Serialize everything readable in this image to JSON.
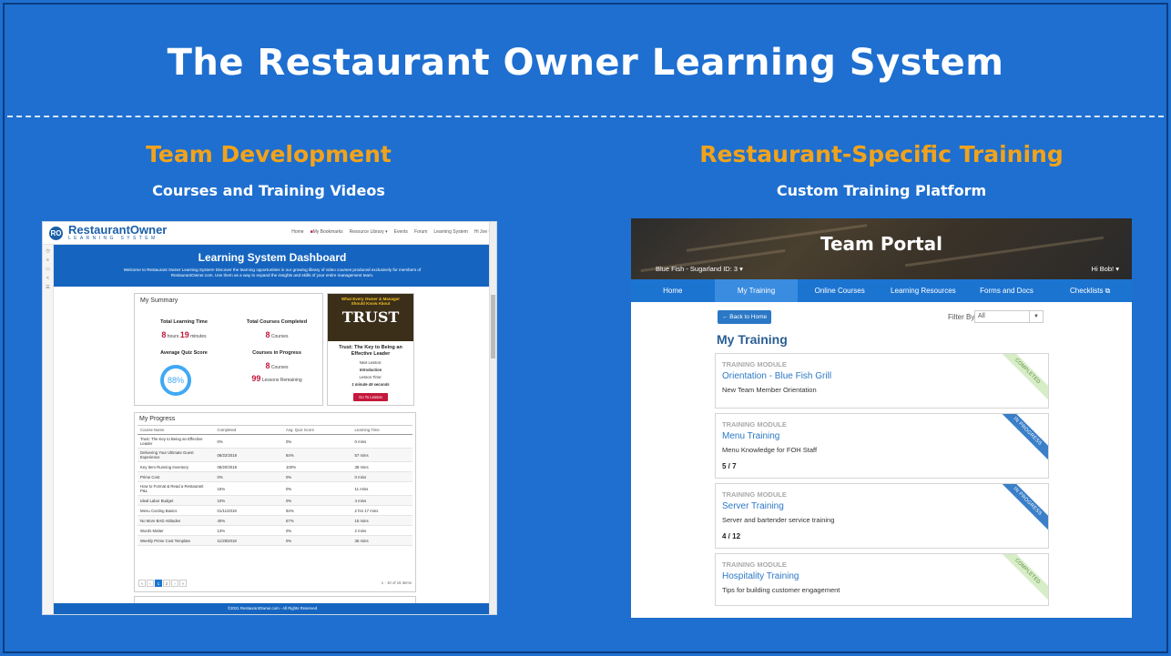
{
  "slide": {
    "title": "The Restaurant Owner Learning System",
    "left_heading": "Team Development",
    "left_subheading": "Courses and Training Videos",
    "right_heading": "Restaurant-Specific Training",
    "right_subheading": "Custom Training Platform"
  },
  "dashboard": {
    "logo_mark": "RO",
    "logo_text": "RestaurantOwner",
    "logo_sub": "LEARNING SYSTEM",
    "nav": [
      "Home",
      "My Bookmarks",
      "Resource Library ▾",
      "Events",
      "Forum",
      "Learning System",
      "Hi Joe ▾"
    ],
    "banner_title": "Learning System Dashboard",
    "banner_text": "Welcome to Restaurant Owner Learning System! Discover the learning opportunities in our growing library of video courses produced exclusively for members of RestaurantOwner.com. Use them as a way to expand the insights and skills of your entire management team.",
    "summary": {
      "title": "My Summary",
      "learning_time_label": "Total Learning Time",
      "hours": "8",
      "hours_unit": "hours",
      "minutes": "19",
      "minutes_unit": "minutes",
      "completed_label": "Total Courses Completed",
      "completed": "8",
      "completed_unit": "Courses",
      "quiz_label": "Average Quiz Score",
      "quiz": "88%",
      "in_progress_label": "Courses in Progress",
      "in_progress": "8",
      "in_progress_unit": "Courses",
      "lessons": "99",
      "lessons_unit": "Lessons Remaining"
    },
    "promo": {
      "img_line1": "What Every Owner & Manager",
      "img_line2": "Should Know About",
      "img_word": "TRUST",
      "title": "Trust: The Key to Being an Effective Leader",
      "next_label": "Next Lesson:",
      "next_value": "Introduction",
      "time_label": "Lesson Time:",
      "time_value": "1 minute 49 seconds",
      "button": "Go To Lesson"
    },
    "progress": {
      "title": "My Progress",
      "columns": [
        "Course Name",
        "Completed",
        "Avg. Quiz Score",
        "Learning Time"
      ],
      "rows": [
        [
          "Trust: The Key to Being an Effective Leader",
          "0%",
          "0%",
          "0 mins"
        ],
        [
          "Delivering Your Ultimate Guest Experience",
          "08/22/2018",
          "84%",
          "57 mins"
        ],
        [
          "Key Item Running Inventory",
          "08/20/2018",
          "100%",
          "38 mins"
        ],
        [
          "Prime Cost",
          "0%",
          "0%",
          "0 mins"
        ],
        [
          "How to Format & Read a Restaurant P&L",
          "16%",
          "0%",
          "11 mins"
        ],
        [
          "Ideal Labor Budget",
          "10%",
          "0%",
          "4 mins"
        ],
        [
          "Menu Costing Basics",
          "01/11/2019",
          "94%",
          "2 hrs 17 mins"
        ],
        [
          "No More BAD Attitudes",
          "40%",
          "67%",
          "15 mins"
        ],
        [
          "Words Matter",
          "13%",
          "0%",
          "2 mins"
        ],
        [
          "Weekly Prime Cost Template",
          "11/28/2018",
          "0%",
          "35 mins"
        ]
      ],
      "pager": [
        "«",
        "‹",
        "1",
        "2",
        "›",
        "»"
      ],
      "count": "1 - 10 of 16 items"
    },
    "footer": "©2021 RestaurantOwner.com - All Rights Reserved"
  },
  "portal": {
    "title": "Team Portal",
    "location": "Blue Fish - Sugarland ID: 3 ▾",
    "user": "Hi Bob! ▾",
    "nav": [
      "Home",
      "My Training",
      "Online Courses",
      "Learning Resources",
      "Forms and Docs",
      "Checklists ⧉"
    ],
    "back_button": "← Back to Home",
    "filter_label": "Filter By:",
    "filter_value": "All",
    "heading": "My Training",
    "modules": [
      {
        "kicker": "TRAINING MODULE",
        "title": "Orientation - Blue Fish Grill",
        "desc": "New Team Member Orientation",
        "count": "",
        "status": "COMPLETED"
      },
      {
        "kicker": "TRAINING MODULE",
        "title": "Menu Training",
        "desc": "Menu Knowledge for FOH Staff",
        "count": "5 / 7",
        "status": "IN PROGRESS"
      },
      {
        "kicker": "TRAINING MODULE",
        "title": "Server Training",
        "desc": "Server and bartender service training",
        "count": "4 / 12",
        "status": "IN PROGRESS"
      },
      {
        "kicker": "TRAINING MODULE",
        "title": "Hospitality Training",
        "desc": "Tips for building customer engagement",
        "count": "",
        "status": "COMPLETED"
      }
    ]
  },
  "colors": {
    "background": "#1e6fd0",
    "accent": "#f2a31b",
    "portal_nav": "#1c74d1",
    "completed_ribbon": "#d7edc8",
    "progress_ribbon": "#3a7fc8"
  }
}
